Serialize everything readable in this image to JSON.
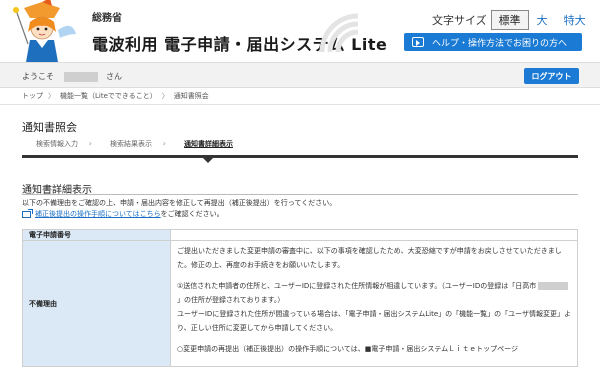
{
  "header": {
    "ministry": "総務省",
    "system_name": "電波利用 電子申請・届出システム Lite",
    "font_size": {
      "label": "文字サイズ",
      "options": [
        "標準",
        "大",
        "特大"
      ],
      "selected": "標準"
    },
    "help_label": "ヘルプ・操作方法でお困りの方へ"
  },
  "userbar": {
    "greeting": "ようこそ",
    "honorific": "さん",
    "logout_label": "ログアウト"
  },
  "breadcrumb": [
    "トップ",
    "機能一覧（Liteでできること）",
    "通知書照会"
  ],
  "page": {
    "title": "通知書照会",
    "steps": [
      "検索情報入力",
      "検索結果表示",
      "通知書詳細表示"
    ],
    "current_step": "通知書詳細表示"
  },
  "detail": {
    "section_title": "通知書詳細表示",
    "notice": "以下の不備理由をご確認の上、申請・届出内容を修正して再提出（補正後提出）を行ってください。",
    "link_text": "補正後提出の操作手順についてはこちら",
    "link_suffix": "をご確認ください。",
    "table": {
      "label_application_number": "電子申請番号",
      "label_reason": "不備理由",
      "reason_p1": "ご提出いただきました変更申請の審査中に、以下の事項を確認したため、大変恐縮ですが申請をお戻しさせていただきました。修正の上、再度のお手続きをお願いいたします。",
      "reason_p2a": "①送信された申請者の住所と、ユーザーIDに登録された住所情報が相違しています。（ユーザーIDの登録は「日高市",
      "reason_p2b": "」の住所が登録されております。）",
      "reason_p3": "ユーザーIDに登録された住所が間違っている場合は、「電子申請・届出システムLite」の「機能一覧」の「ユーザ情報変更」より、正しい住所に変更してから申請してください。",
      "reason_p4": "○変更申請の再提出（補正後提出）の操作手順については、■電子申請・届出システムＬｉｔｅトップページ"
    }
  },
  "colors": {
    "accent_blue": "#1a7ad4",
    "table_header_bg": "#dbe8f6"
  }
}
